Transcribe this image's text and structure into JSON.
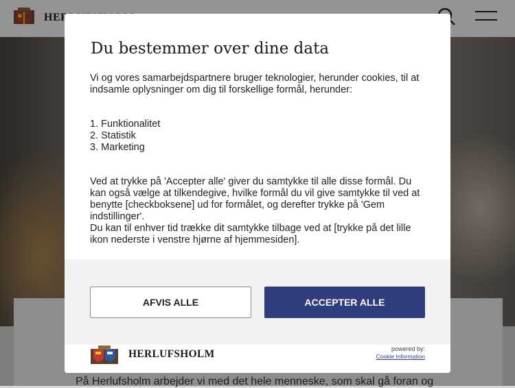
{
  "site": {
    "logo_text": "HERLUFSHOLM",
    "intro_text": "På Herlufsholm arbejder vi med det hele menneske, som skal gå foran og"
  },
  "consent": {
    "title": "Du bestemmer over dine data",
    "intro": "Vi og vores samarbejdspartnere bruger teknologier, herunder cookies, til at indsamle oplysninger om dig til forskellige formål, herunder:",
    "purposes": [
      "1. Funktionalitet",
      "2. Statistik",
      "3. Marketing"
    ],
    "paragraph1": "Ved at trykke på 'Accepter alle' giver du samtykke til alle disse formål. Du kan også vælge at tilkendegive, hvilke formål du vil give samtykke til ved at benytte [checkboksene] ud for formålet, og derefter trykke på 'Gem indstillinger'.",
    "paragraph2": "Du kan til enhver tid trække dit samtykke tilbage ved at [trykke på det lille ikon nederste i venstre hjørne af hjemmesiden].",
    "reject_label": "AFVIS ALLE",
    "accept_label": "ACCEPTER ALLE",
    "footer": {
      "brand": "HERLUFSHOLM",
      "powered_by": "powered by:",
      "cookie_info": "Cookie Information"
    }
  },
  "colors": {
    "accent": "#2f3c7e",
    "overlay": "rgba(0,0,0,0.42)"
  },
  "icons": {
    "search": "search-icon",
    "menu": "menu-icon",
    "crest": "crest-icon"
  }
}
